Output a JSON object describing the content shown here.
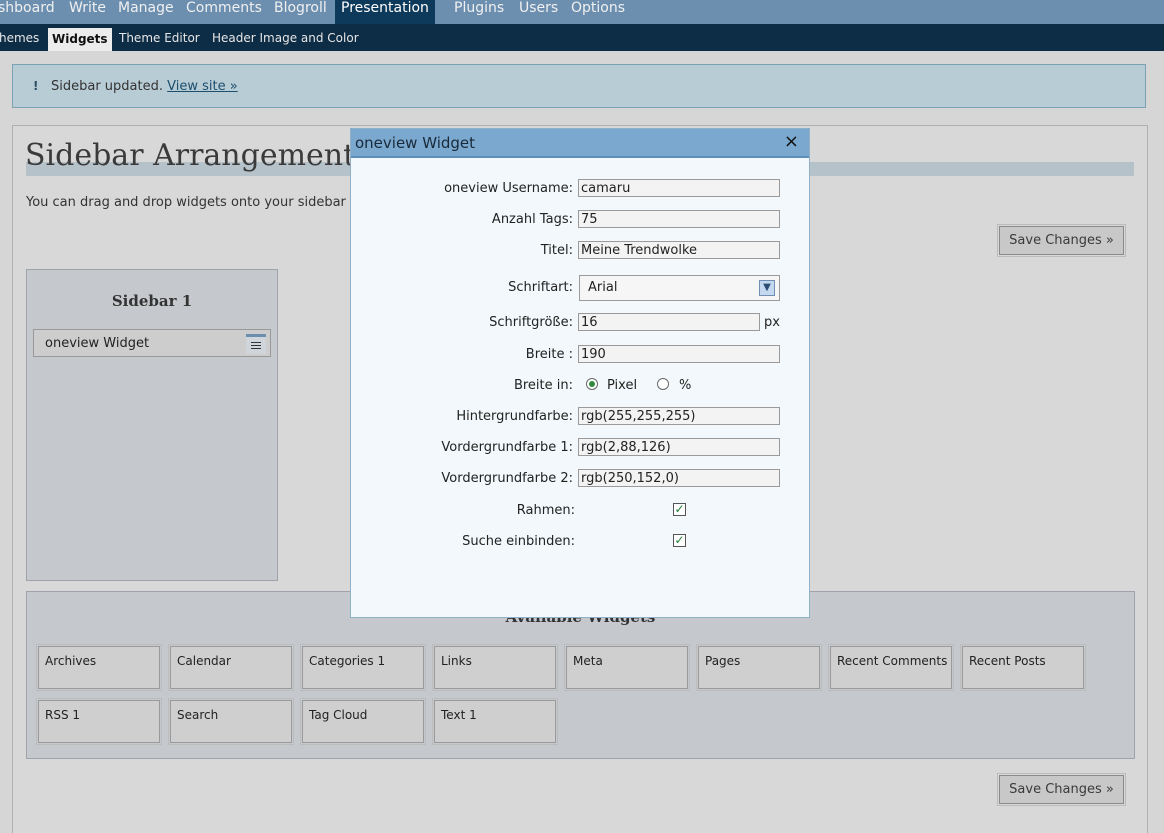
{
  "admin_menu": {
    "items": [
      {
        "label": "shboard"
      },
      {
        "label": "Write"
      },
      {
        "label": "Manage"
      },
      {
        "label": "Comments"
      },
      {
        "label": "Blogroll"
      },
      {
        "label": "Presentation"
      },
      {
        "label": "Plugins"
      },
      {
        "label": "Users"
      },
      {
        "label": "Options"
      }
    ]
  },
  "sub_menu": {
    "items": [
      {
        "label": "hemes"
      },
      {
        "label": "Widgets"
      },
      {
        "label": "Theme Editor"
      },
      {
        "label": "Header Image and Color"
      }
    ]
  },
  "notice": {
    "icon": "!",
    "message": "Sidebar updated.",
    "link": "View site »"
  },
  "page": {
    "title": "Sidebar Arrangement",
    "intro": "You can drag and drop widgets onto your sidebar be",
    "save_label": "Save Changes »"
  },
  "sidebar": {
    "title": "Sidebar 1",
    "widgets": [
      {
        "label": "oneview Widget"
      }
    ]
  },
  "available": {
    "title": "Available Widgets",
    "widgets": [
      {
        "label": "Archives"
      },
      {
        "label": "Calendar"
      },
      {
        "label": "Categories 1"
      },
      {
        "label": "Links"
      },
      {
        "label": "Meta"
      },
      {
        "label": "Pages"
      },
      {
        "label": "Recent Comments"
      },
      {
        "label": "Recent Posts"
      },
      {
        "label": "RSS 1"
      },
      {
        "label": "Search"
      },
      {
        "label": "Tag Cloud"
      },
      {
        "label": "Text 1"
      }
    ]
  },
  "modal": {
    "title": "oneview Widget",
    "close": "×",
    "fields": {
      "username": {
        "label": "oneview Username:",
        "value": "camaru"
      },
      "tags": {
        "label": "Anzahl Tags:",
        "value": "75"
      },
      "titel": {
        "label": "Titel:",
        "value": "Meine Trendwolke"
      },
      "font": {
        "label": "Schriftart:",
        "value": "Arial"
      },
      "fontsize": {
        "label": "Schriftgröße:",
        "value": "16",
        "unit": "px"
      },
      "width": {
        "label": "Breite :",
        "value": "190"
      },
      "width_in": {
        "label": "Breite in:",
        "option_pixel": "Pixel",
        "option_percent": "%",
        "selected": "Pixel"
      },
      "bg": {
        "label": "Hintergrundfarbe:",
        "value": "rgb(255,255,255)"
      },
      "fg1": {
        "label": "Vordergrundfarbe 1:",
        "value": "rgb(2,88,126)"
      },
      "fg2": {
        "label": "Vordergrundfarbe 2:",
        "value": "rgb(250,152,0)"
      },
      "border": {
        "label": "Rahmen:",
        "checked": true
      },
      "search": {
        "label": "Suche einbinden:",
        "checked": true
      }
    }
  },
  "colors": {
    "menu_bg": "#6c8fb0",
    "submenu_bg": "#0d2c45",
    "modal_header": "#7aa8cf",
    "check_green": "#1f7d2e"
  }
}
